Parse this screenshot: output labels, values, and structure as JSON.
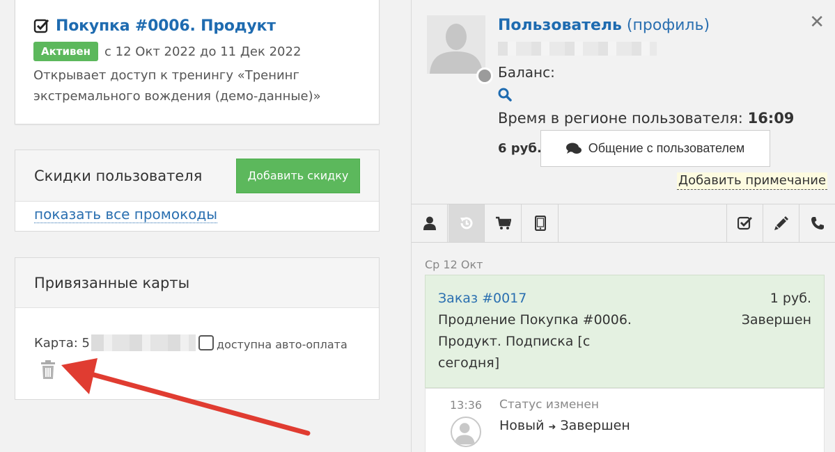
{
  "purchase": {
    "title": "Покупка #0006. Продукт",
    "status": "Активен",
    "period": "с 12 Окт 2022 до 11 Дек 2022",
    "description": "Открывает доступ к тренингу «Тренинг экстремального вождения (демо-данные)»"
  },
  "discounts": {
    "title": "Скидки пользователя",
    "add_button": "Добавить скидку",
    "promo_link": "показать все промокоды"
  },
  "cards": {
    "title": "Привязанные карты",
    "card_label": "Карта: 5",
    "autopay_label": "доступна авто-оплата"
  },
  "user": {
    "name": "Пользователь",
    "profile_link": "(профиль)",
    "balance_label": "Баланс:",
    "time_label": "Время в регионе пользователя:",
    "time_value": "16:09",
    "amount": "6 руб.",
    "chat_button": "Общение с пользователем",
    "add_note": "Добавить примечание",
    "close": "✕"
  },
  "tabs": [
    {
      "icon": "user-icon"
    },
    {
      "icon": "history-icon"
    },
    {
      "icon": "cart-icon"
    },
    {
      "icon": "mobile-icon"
    },
    {
      "icon": "checkbox-icon"
    },
    {
      "icon": "pencil-icon"
    },
    {
      "icon": "phone-icon"
    }
  ],
  "timeline": {
    "date": "Ср 12 Окт",
    "order": {
      "id": "Заказ #0017",
      "amount": "1 руб.",
      "description": "Продление Покупка #0006. Продукт. Подписка [с сегодня]",
      "status": "Завершен"
    },
    "event": {
      "time": "13:36",
      "title": "Статус изменен",
      "from": "Новый",
      "arrow": "➜",
      "to": "Завершен"
    }
  },
  "colors": {
    "accent_blue": "#1e6bb0",
    "success_green": "#5cb85c",
    "order_bg": "#e4f1e1",
    "annotation_red": "#e03c31"
  }
}
